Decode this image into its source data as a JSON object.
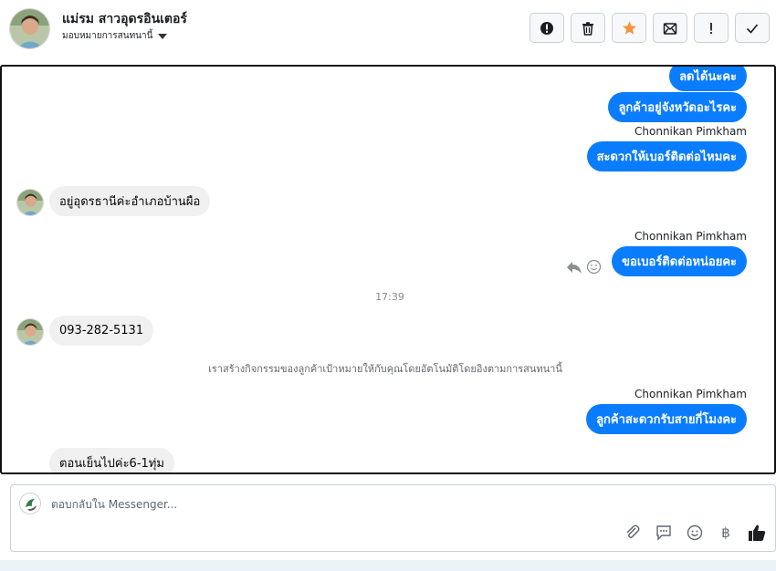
{
  "header": {
    "contact_name": "แม่รม สาวอุดรอินเตอร์",
    "assign_label": "มอบหมายการสนทนานี้",
    "toolbar": [
      {
        "name": "spam-button",
        "icon": "alert-circle-icon"
      },
      {
        "name": "delete-button",
        "icon": "trash-icon"
      },
      {
        "name": "star-button",
        "icon": "star-icon",
        "color": "#f7923b"
      },
      {
        "name": "mark-unread-button",
        "icon": "envelope-icon"
      },
      {
        "name": "follow-up-button",
        "icon": "exclamation-icon"
      },
      {
        "name": "done-button",
        "icon": "check-icon"
      }
    ]
  },
  "messages": {
    "m1": "ลดได้นะคะ",
    "m2": "ลูกค้าอยู่จังหวัดอะไรคะ",
    "m2_sender": "Chonnikan Pimkham",
    "m3": "สะดวกให้เบอร์ติดต่อไหมคะ",
    "m4": "อยู่อุดรธานีค่ะอำเภอบ้านผือ",
    "m5_sender": "Chonnikan Pimkham",
    "m5": "ขอเบอร์ติดต่อหน่อยคะ",
    "time": "17:39",
    "m6": "093-282-5131",
    "system": "เราสร้างกิจกรรมของลูกค้าเป้าหมายให้กับคุณโดยอัตโนมัติโดยอิงตามการสนทนานี้",
    "m7_sender": "Chonnikan Pimkham",
    "m7": "ลูกค้าสะดวกรับสายกี่โมงคะ",
    "m8": "ตอนเย็นไปค่ะ6-1ทุ่ม"
  },
  "composer": {
    "placeholder": "ตอบกลับใน Messenger...",
    "tools": [
      "paperclip-icon",
      "comment-icon",
      "emoji-icon",
      "baht-icon",
      "thumbs-up-icon"
    ],
    "baht_symbol": "฿"
  },
  "colors": {
    "outgoing": "#0a7cff",
    "incoming": "#f0f0f0",
    "accent_star": "#f7923b"
  }
}
